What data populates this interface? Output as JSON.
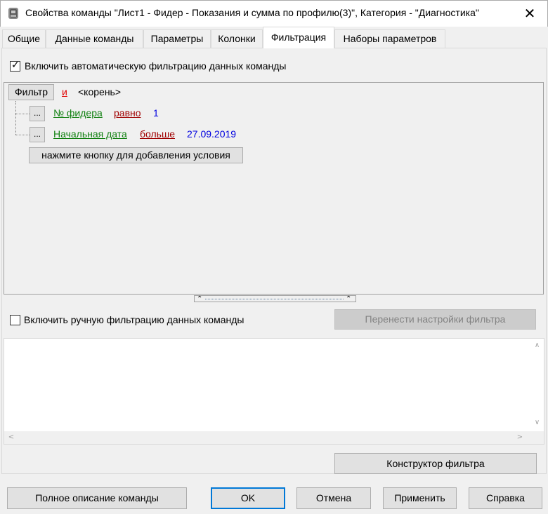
{
  "window": {
    "title": "Свойства команды \"Лист1 - Фидер - Показания и сумма по профилю(3)\", Категория - \"Диагностика\"",
    "close_glyph": "✕",
    "app_icon": "grey-knight-icon"
  },
  "tabs": [
    {
      "label": "Общие"
    },
    {
      "label": "Данные команды"
    },
    {
      "label": "Параметры"
    },
    {
      "label": "Колонки"
    },
    {
      "label": "Фильтрация",
      "active": true
    },
    {
      "label": "Наборы параметров"
    }
  ],
  "auto_filter": {
    "checkbox_label": "Включить автоматическую фильтрацию данных команды",
    "checked": true
  },
  "filter_tree": {
    "root_button": "Фильтр",
    "root_operator": "и",
    "root_label": "<корень>",
    "conditions": [
      {
        "menu_button": "...",
        "field": "№ фидера",
        "operator": "равно",
        "value": "1"
      },
      {
        "menu_button": "...",
        "field": "Начальная дата",
        "operator": "больше",
        "value": "27.09.2019"
      }
    ],
    "add_condition_button": "нажмите кнопку для добавления условия"
  },
  "splitter": {
    "up_glyph": "⌃",
    "down_glyph": "⌃"
  },
  "manual_filter": {
    "checkbox_label": "Включить ручную фильтрацию данных команды",
    "checked": false,
    "transfer_button": "Перенести настройки фильтра"
  },
  "textbox": {
    "value": "",
    "scroll_up": "∧",
    "scroll_down": "∨",
    "scroll_left": "<",
    "scroll_right": ">"
  },
  "constructor_button": "Конструктор фильтра",
  "bottom_buttons": {
    "description": "Полное описание команды",
    "ok": "OK",
    "cancel": "Отмена",
    "apply": "Применить",
    "help": "Справка"
  }
}
